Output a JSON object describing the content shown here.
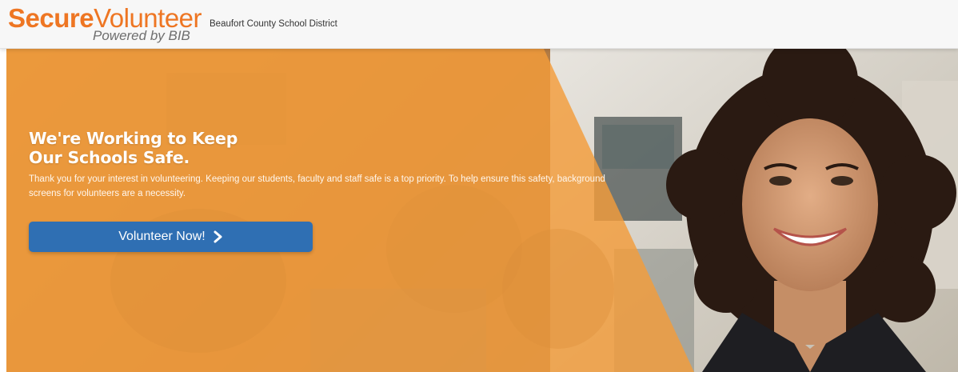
{
  "header": {
    "logo": {
      "secure": "Secure",
      "volunteer": "Volunteer",
      "tagline": "Powered by BIB"
    },
    "district": "Beaufort County School District"
  },
  "hero": {
    "title_line1": "We're Working to Keep",
    "title_line2": "Our Schools Safe.",
    "body": "Thank you for your interest in volunteering. Keeping our students, faculty and staff safe is a top priority. To help ensure this safety, background screens for volunteers are a necessity.",
    "cta_label": "Volunteer Now!",
    "cta_icon": "chevron-right-icon"
  },
  "colors": {
    "brand_orange": "#ee7623",
    "overlay_orange": "#f39c3a",
    "cta_blue": "#2f6fb3",
    "header_bg": "#f7f7f7"
  }
}
